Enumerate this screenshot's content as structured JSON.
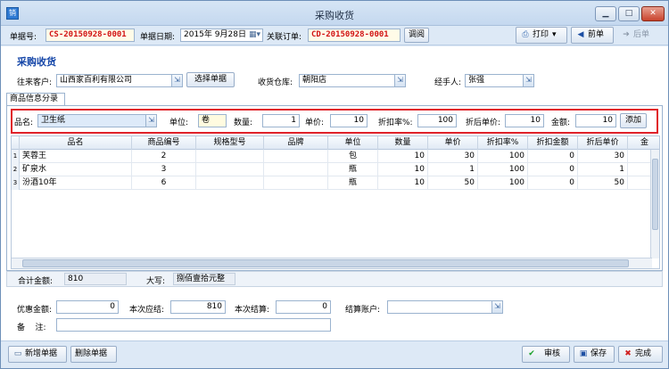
{
  "window": {
    "title": "采购收货",
    "icon_glyph": "销"
  },
  "header": {
    "doc_no_label": "单据号:",
    "doc_no": "CS-20150928-0001",
    "date_label": "单据日期:",
    "date": "2015年 9月28日",
    "related_label": "关联订单:",
    "related": "CD-20150928-0001",
    "lookup_btn": "调阅",
    "print_btn": "打印",
    "prev_btn": "前单",
    "next_btn": "后单"
  },
  "form": {
    "heading": "采购收货",
    "customer_label": "往来客户:",
    "customer": "山西家百利有限公司",
    "select_doc_btn": "选择单据",
    "warehouse_label": "收货仓库:",
    "warehouse": "朝阳店",
    "handler_label": "经手人:",
    "handler": "张强"
  },
  "tab": {
    "label": "商品信息分录"
  },
  "entry": {
    "name_label": "品名:",
    "name": "卫生纸",
    "unit_label": "单位:",
    "unit": "卷",
    "qty_label": "数量:",
    "qty": "1",
    "price_label": "单价:",
    "price": "10",
    "discount_label": "折扣率%:",
    "discount": "100",
    "disc_price_label": "折后单价:",
    "disc_price": "10",
    "amount_label": "金额:",
    "amount": "10",
    "add_btn": "添加"
  },
  "grid": {
    "columns": [
      "品名",
      "商品编号",
      "规格型号",
      "品牌",
      "单位",
      "数量",
      "单价",
      "折扣率%",
      "折扣金额",
      "折后单价",
      "金"
    ],
    "rows": [
      {
        "num": "1",
        "cells": [
          "芙蓉王",
          "2",
          "",
          "",
          "包",
          "10",
          "30",
          "100",
          "0",
          "30"
        ]
      },
      {
        "num": "2",
        "cells": [
          "矿泉水",
          "3",
          "",
          "",
          "瓶",
          "10",
          "1",
          "100",
          "0",
          "1"
        ]
      },
      {
        "num": "3",
        "cells": [
          "汾酒10年",
          "6",
          "",
          "",
          "瓶",
          "10",
          "50",
          "100",
          "0",
          "50"
        ]
      }
    ]
  },
  "totals": {
    "sum_label": "合计金额:",
    "sum": "810",
    "upper_label": "大写:",
    "upper": "捌佰壹拾元整"
  },
  "settle": {
    "discount_label": "优惠金额:",
    "discount": "0",
    "due_label": "本次应结:",
    "due": "810",
    "paid_label": "本次结算:",
    "paid": "0",
    "account_label": "结算账户:",
    "account": "",
    "note_label": "备    注:",
    "note": ""
  },
  "footer": {
    "new_btn": "新增单据",
    "delete_btn": "删除单据",
    "audit_btn": "审核",
    "save_btn": "保存",
    "done_btn": "完成"
  }
}
